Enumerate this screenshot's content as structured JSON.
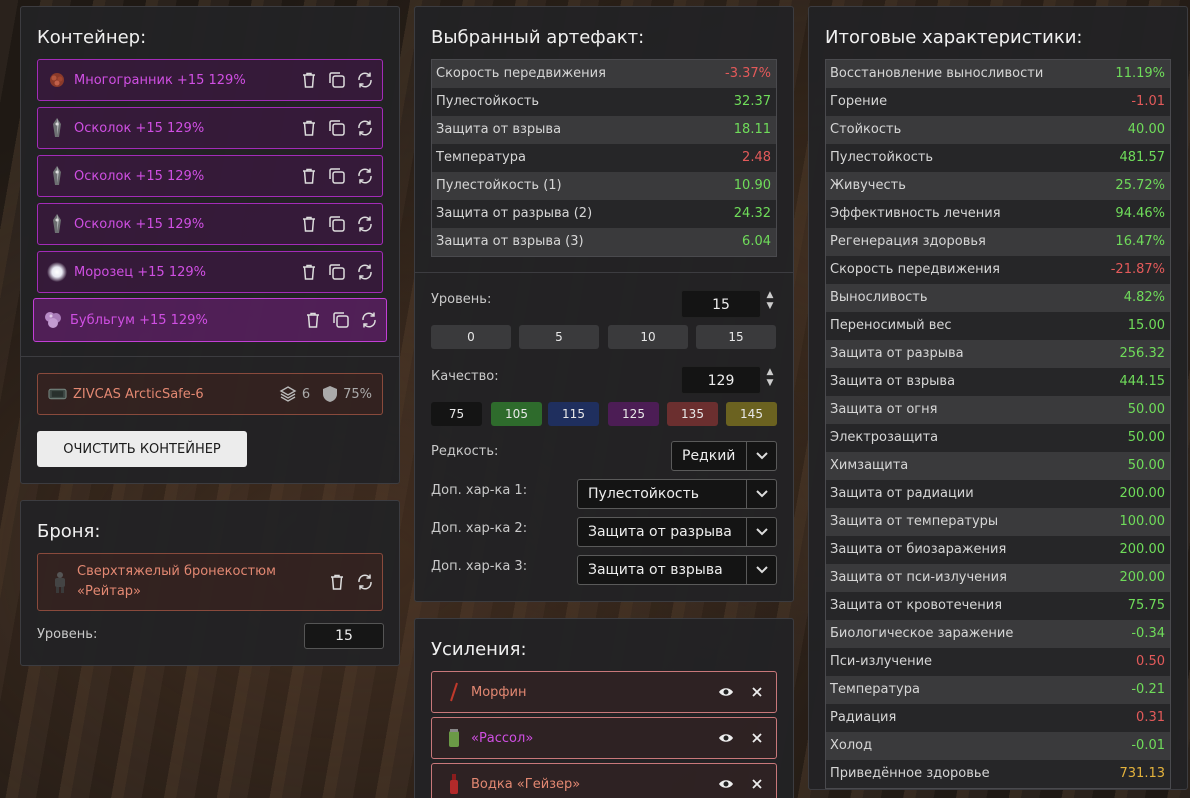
{
  "container": {
    "title": "Контейнер:",
    "artifacts": [
      {
        "label": "Многогранник +15 129%",
        "icon": "polyhedron-icon"
      },
      {
        "label": "Осколок +15 129%",
        "icon": "shard-icon"
      },
      {
        "label": "Осколок +15 129%",
        "icon": "shard-icon"
      },
      {
        "label": "Осколок +15 129%",
        "icon": "shard-icon"
      },
      {
        "label": "Морозец +15 129%",
        "icon": "frost-icon"
      },
      {
        "label": "Бубльгум +15 129%",
        "icon": "bubblegum-icon"
      }
    ],
    "box": {
      "name": "ZIVCAS ArcticSafe-6",
      "slots": "6",
      "protection": "75%"
    },
    "clear_label": "ОЧИСТИТЬ КОНТЕЙНЕР"
  },
  "armor": {
    "title": "Броня:",
    "name_line1": "Сверхтяжелый бронекостюм",
    "name_line2": "«Рейтар»",
    "level_label": "Уровень:",
    "level_value": "15"
  },
  "artifact": {
    "title": "Выбранный артефакт:",
    "stats": [
      {
        "name": "Скорость передвижения",
        "value": "-3.37%",
        "tone": "neg"
      },
      {
        "name": "Пулестойкость",
        "value": "32.37",
        "tone": "pos"
      },
      {
        "name": "Защита от взрыва",
        "value": "18.11",
        "tone": "pos"
      },
      {
        "name": "Температура",
        "value": "2.48",
        "tone": "neg"
      },
      {
        "name": "Пулестойкость (1)",
        "value": "10.90",
        "tone": "pos"
      },
      {
        "name": "Защита от разрыва (2)",
        "value": "24.32",
        "tone": "pos"
      },
      {
        "name": "Защита от взрыва (3)",
        "value": "6.04",
        "tone": "pos"
      }
    ],
    "level_label": "Уровень:",
    "level_value": "15",
    "level_presets": [
      "0",
      "5",
      "10",
      "15"
    ],
    "quality_label": "Качество:",
    "quality_value": "129",
    "quality_presets": [
      {
        "label": "75",
        "color": "#141414"
      },
      {
        "label": "105",
        "color": "#2e6b2c"
      },
      {
        "label": "115",
        "color": "#1f2f5e"
      },
      {
        "label": "125",
        "color": "#4c1d55"
      },
      {
        "label": "135",
        "color": "#6b2f2f"
      },
      {
        "label": "145",
        "color": "#6b6220"
      }
    ],
    "rarity_label": "Редкость:",
    "rarity_value": "Редкий",
    "extra1_label": "Доп. хар-ка 1:",
    "extra1_value": "Пулестойкость",
    "extra2_label": "Доп. хар-ка 2:",
    "extra2_value": "Защита от разрыва",
    "extra3_label": "Доп. хар-ка 3:",
    "extra3_value": "Защита от взрыва"
  },
  "boosts": {
    "title": "Усиления:",
    "items": [
      {
        "label": "Морфин",
        "color": "#e38872",
        "icon": "syringe-icon"
      },
      {
        "label": "«Рассол»",
        "color": "#d04fe3",
        "icon": "jar-icon"
      },
      {
        "label": "Водка «Гейзер»",
        "color": "#e38872",
        "icon": "bottle-icon"
      }
    ]
  },
  "totals": {
    "title": "Итоговые характеристики:",
    "stats": [
      {
        "name": "Восстановление выносливости",
        "value": "11.19%",
        "tone": "pos"
      },
      {
        "name": "Горение",
        "value": "-1.01",
        "tone": "neg"
      },
      {
        "name": "Стойкость",
        "value": "40.00",
        "tone": "pos"
      },
      {
        "name": "Пулестойкость",
        "value": "481.57",
        "tone": "pos"
      },
      {
        "name": "Живучесть",
        "value": "25.72%",
        "tone": "pos"
      },
      {
        "name": "Эффективность лечения",
        "value": "94.46%",
        "tone": "pos"
      },
      {
        "name": "Регенерация здоровья",
        "value": "16.47%",
        "tone": "pos"
      },
      {
        "name": "Скорость передвижения",
        "value": "-21.87%",
        "tone": "neg"
      },
      {
        "name": "Выносливость",
        "value": "4.82%",
        "tone": "pos"
      },
      {
        "name": "Переносимый вес",
        "value": "15.00",
        "tone": "pos"
      },
      {
        "name": "Защита от разрыва",
        "value": "256.32",
        "tone": "pos"
      },
      {
        "name": "Защита от взрыва",
        "value": "444.15",
        "tone": "pos"
      },
      {
        "name": "Защита от огня",
        "value": "50.00",
        "tone": "pos"
      },
      {
        "name": "Электрозащита",
        "value": "50.00",
        "tone": "pos"
      },
      {
        "name": "Химзащита",
        "value": "50.00",
        "tone": "pos"
      },
      {
        "name": "Защита от радиации",
        "value": "200.00",
        "tone": "pos"
      },
      {
        "name": "Защита от температуры",
        "value": "100.00",
        "tone": "pos"
      },
      {
        "name": "Защита от биозаражения",
        "value": "200.00",
        "tone": "pos"
      },
      {
        "name": "Защита от пси-излучения",
        "value": "200.00",
        "tone": "pos"
      },
      {
        "name": "Защита от кровотечения",
        "value": "75.75",
        "tone": "pos"
      },
      {
        "name": "Биологическое заражение",
        "value": "-0.34",
        "tone": "pos"
      },
      {
        "name": "Пси-излучение",
        "value": "0.50",
        "tone": "neg"
      },
      {
        "name": "Температура",
        "value": "-0.21",
        "tone": "pos"
      },
      {
        "name": "Радиация",
        "value": "0.31",
        "tone": "neg"
      },
      {
        "name": "Холод",
        "value": "-0.01",
        "tone": "pos"
      },
      {
        "name": "Приведённое здоровье",
        "value": "731.13",
        "tone": "gold"
      }
    ]
  }
}
